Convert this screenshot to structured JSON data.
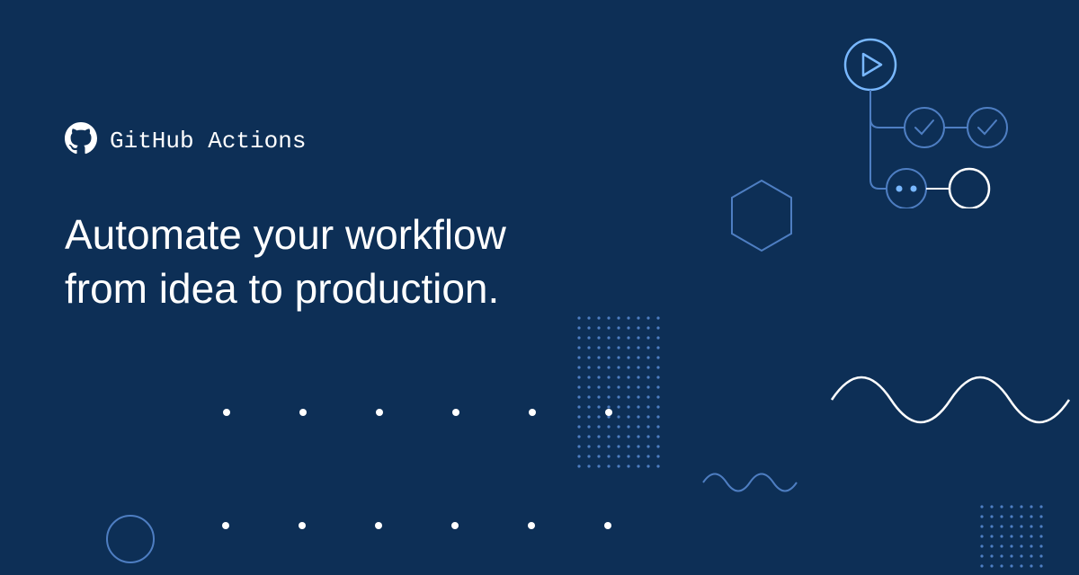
{
  "product": {
    "name": "GitHub Actions"
  },
  "headline": "Automate your workflow\nfrom idea to production.",
  "colors": {
    "background": "#0d2f56",
    "text": "#ffffff",
    "accent_light": "#4e7ec2",
    "accent_bright": "#79b8ff"
  }
}
